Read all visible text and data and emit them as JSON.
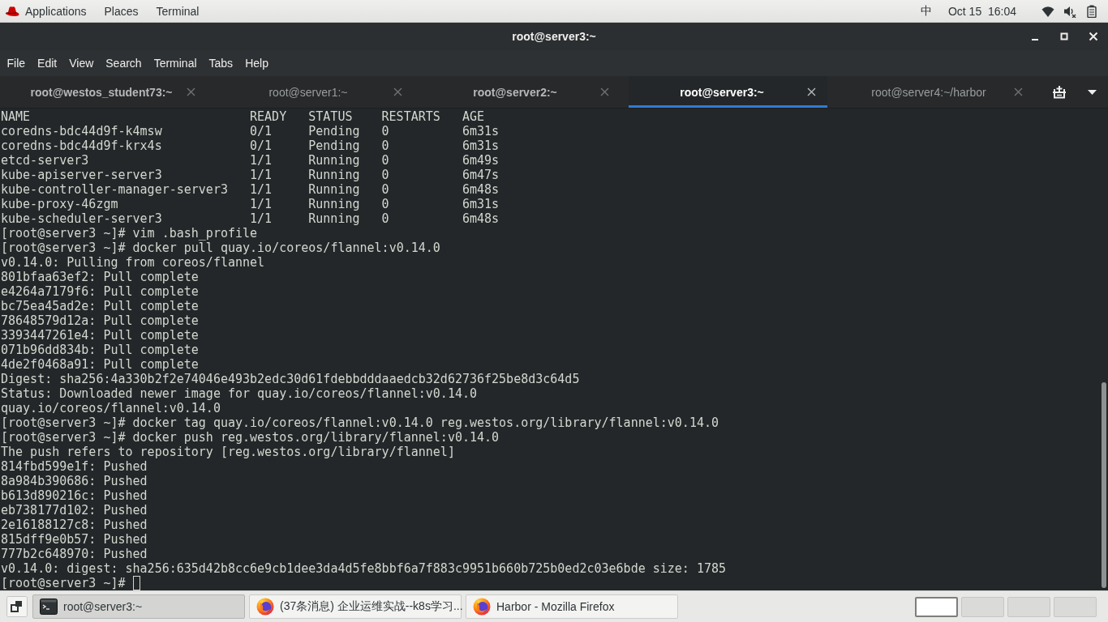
{
  "top_bar": {
    "menus": [
      "Applications",
      "Places",
      "Terminal"
    ],
    "input_method": "中",
    "clock": "Oct 15  16:04"
  },
  "window": {
    "title": "root@server3:~"
  },
  "menu_bar": [
    "File",
    "Edit",
    "View",
    "Search",
    "Terminal",
    "Tabs",
    "Help"
  ],
  "tabs": [
    {
      "label": "root@westos_student73:~",
      "selected": false,
      "activity": true
    },
    {
      "label": "root@server1:~",
      "selected": false,
      "activity": false
    },
    {
      "label": "root@server2:~",
      "selected": false,
      "activity": true
    },
    {
      "label": "root@server3:~",
      "selected": true,
      "activity": false
    },
    {
      "label": "root@server4:~/harbor",
      "selected": false,
      "activity": false
    }
  ],
  "terminal": {
    "pod_table": {
      "columns": [
        "NAME",
        "READY",
        "STATUS",
        "RESTARTS",
        "AGE"
      ],
      "rows": [
        [
          "coredns-bdc44d9f-k4msw",
          "0/1",
          "Pending",
          "0",
          "6m31s"
        ],
        [
          "coredns-bdc44d9f-krx4s",
          "0/1",
          "Pending",
          "0",
          "6m31s"
        ],
        [
          "etcd-server3",
          "1/1",
          "Running",
          "0",
          "6m49s"
        ],
        [
          "kube-apiserver-server3",
          "1/1",
          "Running",
          "0",
          "6m47s"
        ],
        [
          "kube-controller-manager-server3",
          "1/1",
          "Running",
          "0",
          "6m48s"
        ],
        [
          "kube-proxy-46zgm",
          "1/1",
          "Running",
          "0",
          "6m31s"
        ],
        [
          "kube-scheduler-server3",
          "1/1",
          "Running",
          "0",
          "6m48s"
        ]
      ]
    },
    "lines": [
      "[root@server3 ~]# vim .bash_profile",
      "[root@server3 ~]# docker pull quay.io/coreos/flannel:v0.14.0",
      "v0.14.0: Pulling from coreos/flannel",
      "801bfaa63ef2: Pull complete",
      "e4264a7179f6: Pull complete",
      "bc75ea45ad2e: Pull complete",
      "78648579d12a: Pull complete",
      "3393447261e4: Pull complete",
      "071b96dd834b: Pull complete",
      "4de2f0468a91: Pull complete",
      "Digest: sha256:4a330b2f2e74046e493b2edc30d61fdebbdddaaedcb32d62736f25be8d3c64d5",
      "Status: Downloaded newer image for quay.io/coreos/flannel:v0.14.0",
      "quay.io/coreos/flannel:v0.14.0",
      "[root@server3 ~]# docker tag quay.io/coreos/flannel:v0.14.0 reg.westos.org/library/flannel:v0.14.0",
      "[root@server3 ~]# docker push reg.westos.org/library/flannel:v0.14.0",
      "The push refers to repository [reg.westos.org/library/flannel]",
      "814fbd599e1f: Pushed",
      "8a984b390686: Pushed",
      "b613d890216c: Pushed",
      "eb738177d102: Pushed",
      "2e16188127c8: Pushed",
      "815dff9e0b57: Pushed",
      "777b2c648970: Pushed",
      "v0.14.0: digest: sha256:635d42b8cc6e9cb1dee3da4d5fe8bbf6a7f883c9951b660b725b0ed2c03e6bde size: 1785"
    ],
    "prompt": "[root@server3 ~]#"
  },
  "taskbar": {
    "tasks": [
      {
        "kind": "terminal",
        "label": "root@server3:~",
        "selected": true
      },
      {
        "kind": "browser",
        "label": "(37条消息) 企业运维实战--k8s学习...",
        "selected": false
      },
      {
        "kind": "browser",
        "label": "Harbor - Mozilla Firefox",
        "selected": false
      }
    ],
    "workspaces": [
      {
        "selected": true
      },
      {
        "selected": false
      },
      {
        "selected": false
      },
      {
        "selected": false
      }
    ]
  }
}
